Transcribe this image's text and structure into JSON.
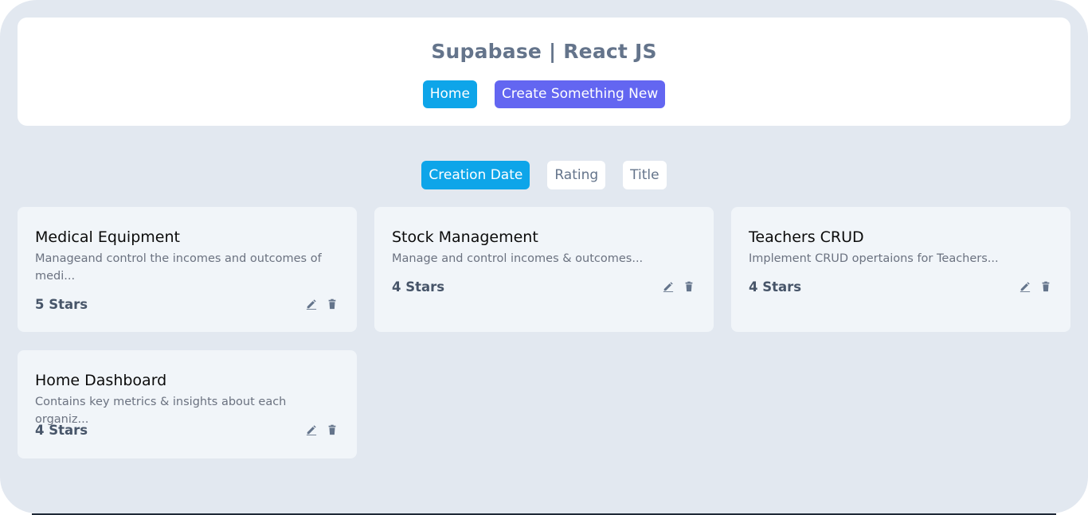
{
  "header": {
    "title": "Supabase | React JS",
    "nav": {
      "home_label": "Home",
      "create_label": "Create Something New"
    }
  },
  "sort": {
    "options": [
      "Creation Date",
      "Rating",
      "Title"
    ],
    "selected": "Creation Date"
  },
  "cards": [
    {
      "title": "Medical Equipment",
      "description": "Manageand control the incomes and outcomes of medi...",
      "rating": "5 Stars"
    },
    {
      "title": "Stock Management",
      "description": "Manage and control incomes & outcomes...",
      "rating": "4 Stars"
    },
    {
      "title": "Teachers CRUD",
      "description": "Implement CRUD opertaions for Teachers...",
      "rating": "4 Stars"
    },
    {
      "title": "Home Dashboard",
      "description": "Contains key metrics & insights about each organiz...",
      "rating": "4 Stars"
    }
  ],
  "icons": {
    "edit": "pencil-icon",
    "delete": "trash-icon"
  },
  "colors": {
    "background": "#e2e8f0",
    "primary": "#0ea5e9",
    "accent": "#6366f1",
    "muted_text": "#64748b",
    "card_bg": "#f1f5f9"
  }
}
